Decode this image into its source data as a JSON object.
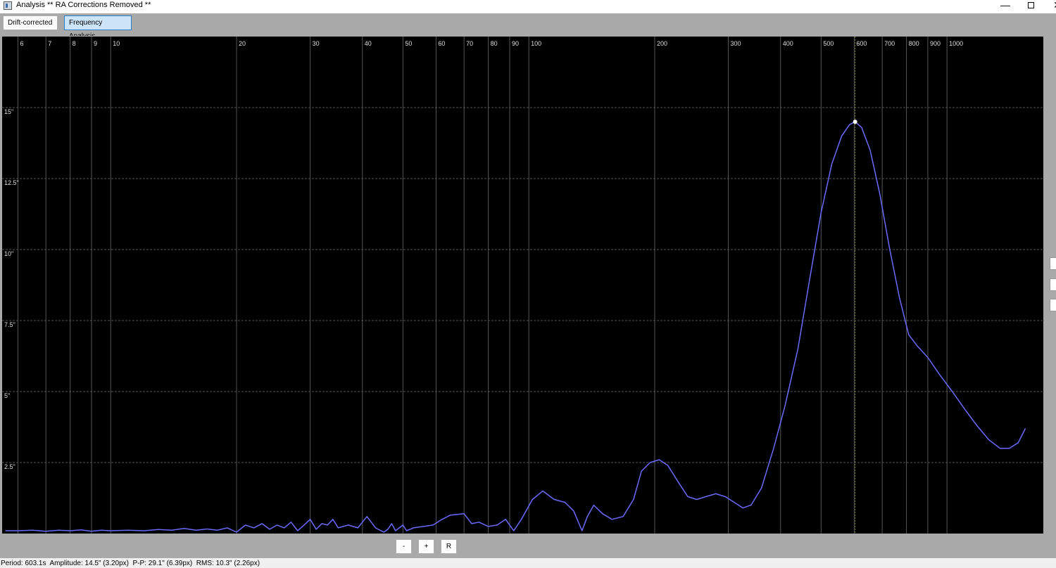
{
  "window": {
    "title": "Analysis ** RA Corrections Removed **",
    "minimize_glyph": "—",
    "close_glyph": "✕"
  },
  "tabs": [
    {
      "label": "Drift-corrected",
      "active": false
    },
    {
      "label": "Frequency Analysis",
      "active": true
    }
  ],
  "zoom": {
    "out_label": "-",
    "in_label": "+",
    "reset_label": "R"
  },
  "status": {
    "text": "Period: 603.1s  Amplitude: 14.5\" (3.20px)  P-P: 29.1\" (6.39px)  RMS: 10.3\" (2.26px)"
  },
  "colors": {
    "curve": "#6a6aff",
    "background": "#000000",
    "marker": "#ffffff",
    "cursor_line": "#7a7a2a"
  },
  "chart_data": {
    "type": "line",
    "x_scale": "log",
    "xlim": [
      5.5,
      1700
    ],
    "ylim": [
      0,
      17.5
    ],
    "x_ticks": [
      6,
      7,
      8,
      9,
      10,
      20,
      30,
      40,
      50,
      60,
      70,
      80,
      90,
      100,
      200,
      300,
      400,
      500,
      600,
      700,
      800,
      900,
      1000
    ],
    "x_tick_labels": [
      "6",
      "7",
      "8",
      "9",
      "10",
      "20",
      "30",
      "40",
      "50",
      "60",
      "70",
      "80",
      "90",
      "100",
      "200",
      "300",
      "400",
      "500",
      "600",
      "700",
      "800",
      "900",
      "1000"
    ],
    "y_ticks": [
      2.5,
      5,
      7.5,
      10,
      12.5,
      15
    ],
    "y_tick_labels": [
      "2.5\"",
      "5\"",
      "7.5\"",
      "10\"",
      "12.5\"",
      "15\""
    ],
    "grid": true,
    "highlight": {
      "x": 603.1,
      "y": 14.5
    },
    "series": [
      {
        "points": [
          [
            5.6,
            0.1
          ],
          [
            6.0,
            0.1
          ],
          [
            6.5,
            0.12
          ],
          [
            7.0,
            0.08
          ],
          [
            7.5,
            0.12
          ],
          [
            8.0,
            0.1
          ],
          [
            8.5,
            0.13
          ],
          [
            9.0,
            0.08
          ],
          [
            9.5,
            0.12
          ],
          [
            10.0,
            0.1
          ],
          [
            11.0,
            0.12
          ],
          [
            12.0,
            0.1
          ],
          [
            13.0,
            0.14
          ],
          [
            14.0,
            0.12
          ],
          [
            15.0,
            0.18
          ],
          [
            16.0,
            0.12
          ],
          [
            17.0,
            0.16
          ],
          [
            18.0,
            0.12
          ],
          [
            19.0,
            0.2
          ],
          [
            20.0,
            0.05
          ],
          [
            21.0,
            0.3
          ],
          [
            22.0,
            0.2
          ],
          [
            23.0,
            0.35
          ],
          [
            24.0,
            0.15
          ],
          [
            25.0,
            0.3
          ],
          [
            26.0,
            0.2
          ],
          [
            27.0,
            0.4
          ],
          [
            28.0,
            0.1
          ],
          [
            29.0,
            0.3
          ],
          [
            30.0,
            0.5
          ],
          [
            31.0,
            0.15
          ],
          [
            32.0,
            0.35
          ],
          [
            33.0,
            0.3
          ],
          [
            34.0,
            0.5
          ],
          [
            35.0,
            0.2
          ],
          [
            37.0,
            0.3
          ],
          [
            39.0,
            0.2
          ],
          [
            41.0,
            0.6
          ],
          [
            43.0,
            0.2
          ],
          [
            45.0,
            0.05
          ],
          [
            46.0,
            0.15
          ],
          [
            47.0,
            0.35
          ],
          [
            48.0,
            0.1
          ],
          [
            50.0,
            0.3
          ],
          [
            51.0,
            0.1
          ],
          [
            53.0,
            0.2
          ],
          [
            56.0,
            0.25
          ],
          [
            59.0,
            0.3
          ],
          [
            62.0,
            0.5
          ],
          [
            65.0,
            0.65
          ],
          [
            70.0,
            0.7
          ],
          [
            73.0,
            0.35
          ],
          [
            76.0,
            0.4
          ],
          [
            80.0,
            0.25
          ],
          [
            84.0,
            0.3
          ],
          [
            88.0,
            0.5
          ],
          [
            92.0,
            0.1
          ],
          [
            96.0,
            0.5
          ],
          [
            102.0,
            1.2
          ],
          [
            108.0,
            1.5
          ],
          [
            115.0,
            1.2
          ],
          [
            122.0,
            1.1
          ],
          [
            128.0,
            0.8
          ],
          [
            134.0,
            0.1
          ],
          [
            138.0,
            0.6
          ],
          [
            143.0,
            1.0
          ],
          [
            150.0,
            0.7
          ],
          [
            158.0,
            0.5
          ],
          [
            168.0,
            0.6
          ],
          [
            178.0,
            1.2
          ],
          [
            186.0,
            2.2
          ],
          [
            195.0,
            2.5
          ],
          [
            205.0,
            2.6
          ],
          [
            215.0,
            2.4
          ],
          [
            228.0,
            1.8
          ],
          [
            240.0,
            1.3
          ],
          [
            252.0,
            1.2
          ],
          [
            265.0,
            1.3
          ],
          [
            280.0,
            1.4
          ],
          [
            295.0,
            1.3
          ],
          [
            310.0,
            1.1
          ],
          [
            325.0,
            0.9
          ],
          [
            340.0,
            1.0
          ],
          [
            360.0,
            1.6
          ],
          [
            385.0,
            3.0
          ],
          [
            410.0,
            4.5
          ],
          [
            440.0,
            6.5
          ],
          [
            470.0,
            9.0
          ],
          [
            500.0,
            11.3
          ],
          [
            530.0,
            13.0
          ],
          [
            560.0,
            14.0
          ],
          [
            585.0,
            14.4
          ],
          [
            603.1,
            14.5
          ],
          [
            625.0,
            14.3
          ],
          [
            655.0,
            13.5
          ],
          [
            690.0,
            12.0
          ],
          [
            730.0,
            10.0
          ],
          [
            770.0,
            8.3
          ],
          [
            810.0,
            7.0
          ],
          [
            850.0,
            6.6
          ],
          [
            900.0,
            6.2
          ],
          [
            960.0,
            5.6
          ],
          [
            1030.0,
            5.0
          ],
          [
            1100.0,
            4.4
          ],
          [
            1180.0,
            3.8
          ],
          [
            1260.0,
            3.3
          ],
          [
            1340.0,
            3.0
          ],
          [
            1410.0,
            3.0
          ],
          [
            1480.0,
            3.2
          ],
          [
            1540.0,
            3.7
          ]
        ]
      }
    ]
  }
}
